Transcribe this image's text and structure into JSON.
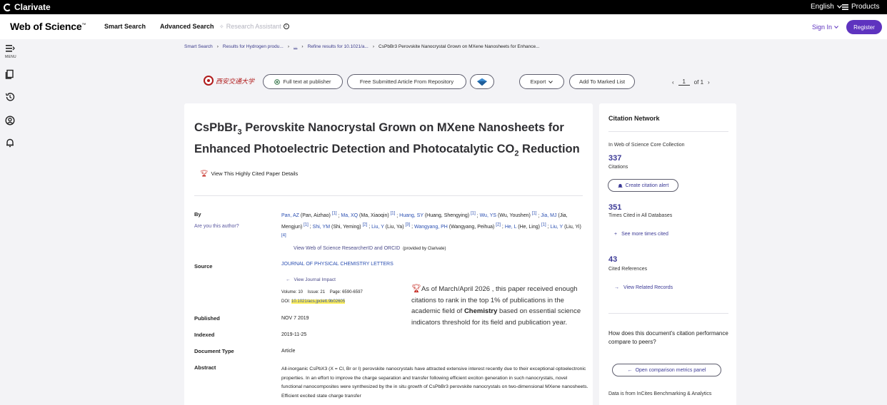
{
  "topbar": {
    "brand": "Clarivate",
    "language": "English",
    "products": "Products"
  },
  "header": {
    "title": "Web of Science",
    "trademark": "™",
    "nav": [
      "Smart Search",
      "Advanced Search"
    ],
    "research_assistant": "Research Assistant",
    "sign_in": "Sign In",
    "register": "Register"
  },
  "rail": {
    "menu_label": "MENU"
  },
  "breadcrumb": {
    "items": [
      "Smart Search",
      "Results for Hydrogen produ...",
      "...",
      "Refine results for 10.1021/a..."
    ],
    "current": "CsPbBr3 Perovskite Nanocrystal Grown on MXene Nanosheets for Enhance..."
  },
  "toolbar": {
    "university_name": "西安交通大学",
    "full_text": "Full text at publisher",
    "free_article": "Free Submitted Article From Repository",
    "export": "Export",
    "add_to_list": "Add To Marked List",
    "page_current": "1",
    "page_total": "of 1"
  },
  "record": {
    "title_part1": "CsPbBr",
    "title_sub1": "3",
    "title_part2": " Perovskite Nanocrystal Grown on MXene Nanosheets for Enhanced Photoelectric Detection and Photocatalytic CO",
    "title_sub2": "2",
    "title_part3": " Reduction",
    "highly_cited_link": "View This Highly Cited Paper Details",
    "by_label": "By",
    "are_you_author": "Are you this author?",
    "authors": [
      {
        "short": "Pan, AZ",
        "full": "(Pan, Aizhao)",
        "aff": "[1]"
      },
      {
        "short": "Ma, XQ",
        "full": "(Ma, Xiaoqin)",
        "aff": "[1]"
      },
      {
        "short": "Huang, SY",
        "full": "(Huang, Shengying)",
        "aff": "[1]"
      },
      {
        "short": "Wu, YS",
        "full": "(Wu, Youshen)",
        "aff": "[1]"
      },
      {
        "short": "Jia, MJ",
        "full": "(Jia, Mengjun)",
        "aff": "[1]"
      },
      {
        "short": "Shi, YM",
        "full": "(Shi, Yeming)",
        "aff": "[2]"
      },
      {
        "short": "Liu, Y",
        "full": "(Liu, Ya)",
        "aff": "[3]"
      },
      {
        "short": "Wangyang, PH",
        "full": "(Wangyang, Peihua)",
        "aff": "[2]"
      },
      {
        "short": "He, L",
        "full": "(He, Ling)",
        "aff": "[1]"
      },
      {
        "short": "Liu, Y",
        "full": "(Liu, Yi)",
        "aff": "[4]"
      }
    ],
    "researcher_id_link": "View Web of Science ResearcherID and ORCID",
    "researcher_id_note": "(provided by Clarivate)",
    "source_label": "Source",
    "journal": "JOURNAL OF PHYSICAL CHEMISTRY LETTERS",
    "journal_impact": "View Journal Impact",
    "volume": "Volume: 10",
    "issue": "Issue: 21",
    "pages": "Page: 6590-6597",
    "doi_label": "DOI:",
    "doi": "10.1021/acs.jpclett.9b02605",
    "highly_cited_text_1": "As of March/April 2026 , this paper received enough citations to rank in the top 1% of publications in the academic field of ",
    "highly_cited_field": "Chemistry",
    "highly_cited_text_2": " based on essential science indicators threshold for its field and publication year.",
    "published_label": "Published",
    "published": "NOV 7 2019",
    "indexed_label": "Indexed",
    "indexed": "2019-11-25",
    "doctype_label": "Document Type",
    "doctype": "Article",
    "abstract_label": "Abstract",
    "abstract": "All-inorganic CsPbX3 (X = Cl, Br or I) perovskite nanocrystals have attracted extensive interest recently due to their exceptional optoelectronic properties. In an effort to improve the charge separation and transfer following efficient exciton generation in such nanocrystals, novel functional nanocomposites were synthesized by the in situ growth of CsPbBr3 perovskite nanocrystals on two-dimensional MXene nanosheets. Efficient excited state charge transfer"
  },
  "citation_network": {
    "title": "Citation Network",
    "collection": "In Web of Science Core Collection",
    "citations_count": "337",
    "citations_label": "Citations",
    "create_alert": "Create citation alert",
    "all_db_count": "351",
    "all_db_label": "Times Cited in All Databases",
    "see_more": "See more times cited",
    "refs_count": "43",
    "refs_label": "Cited References",
    "related": "View Related Records",
    "question": "How does this document's citation performance compare to peers?",
    "open_panel": "Open comparison metrics panel",
    "data_source": "Data is from InCites Benchmarking & Analytics"
  }
}
